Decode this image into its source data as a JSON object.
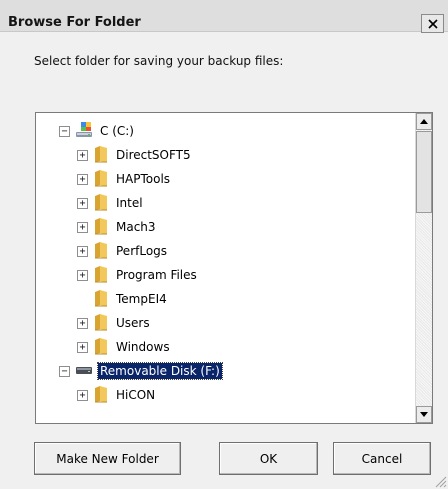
{
  "window": {
    "title": "Browse For Folder",
    "prompt": "Select folder for saving your backup files:"
  },
  "tree": {
    "items": [
      {
        "label": "C (C:)",
        "level": 0,
        "expander": "−",
        "icon": "drive-icon",
        "selected": false
      },
      {
        "label": "DirectSOFT5",
        "level": 1,
        "expander": "+",
        "icon": "folder-icon",
        "selected": false
      },
      {
        "label": "HAPTools",
        "level": 1,
        "expander": "+",
        "icon": "folder-icon",
        "selected": false
      },
      {
        "label": "Intel",
        "level": 1,
        "expander": "+",
        "icon": "folder-icon",
        "selected": false
      },
      {
        "label": "Mach3",
        "level": 1,
        "expander": "+",
        "icon": "folder-icon",
        "selected": false
      },
      {
        "label": "PerfLogs",
        "level": 1,
        "expander": "+",
        "icon": "folder-icon",
        "selected": false
      },
      {
        "label": "Program Files",
        "level": 1,
        "expander": "+",
        "icon": "folder-icon",
        "selected": false
      },
      {
        "label": "TempEI4",
        "level": 1,
        "expander": "",
        "icon": "folder-icon",
        "selected": false
      },
      {
        "label": "Users",
        "level": 1,
        "expander": "+",
        "icon": "folder-icon",
        "selected": false
      },
      {
        "label": "Windows",
        "level": 1,
        "expander": "+",
        "icon": "folder-icon",
        "selected": false
      },
      {
        "label": "Removable Disk (F:)",
        "level": 0,
        "expander": "−",
        "icon": "removable-disk-icon",
        "selected": true
      },
      {
        "label": "HiCON",
        "level": 1,
        "expander": "+",
        "icon": "folder-icon",
        "selected": false
      }
    ]
  },
  "buttons": {
    "make_new_folder": "Make New Folder",
    "ok": "OK",
    "cancel": "Cancel"
  },
  "colors": {
    "selection": "#0a246a",
    "folder": "#e8b84a"
  }
}
